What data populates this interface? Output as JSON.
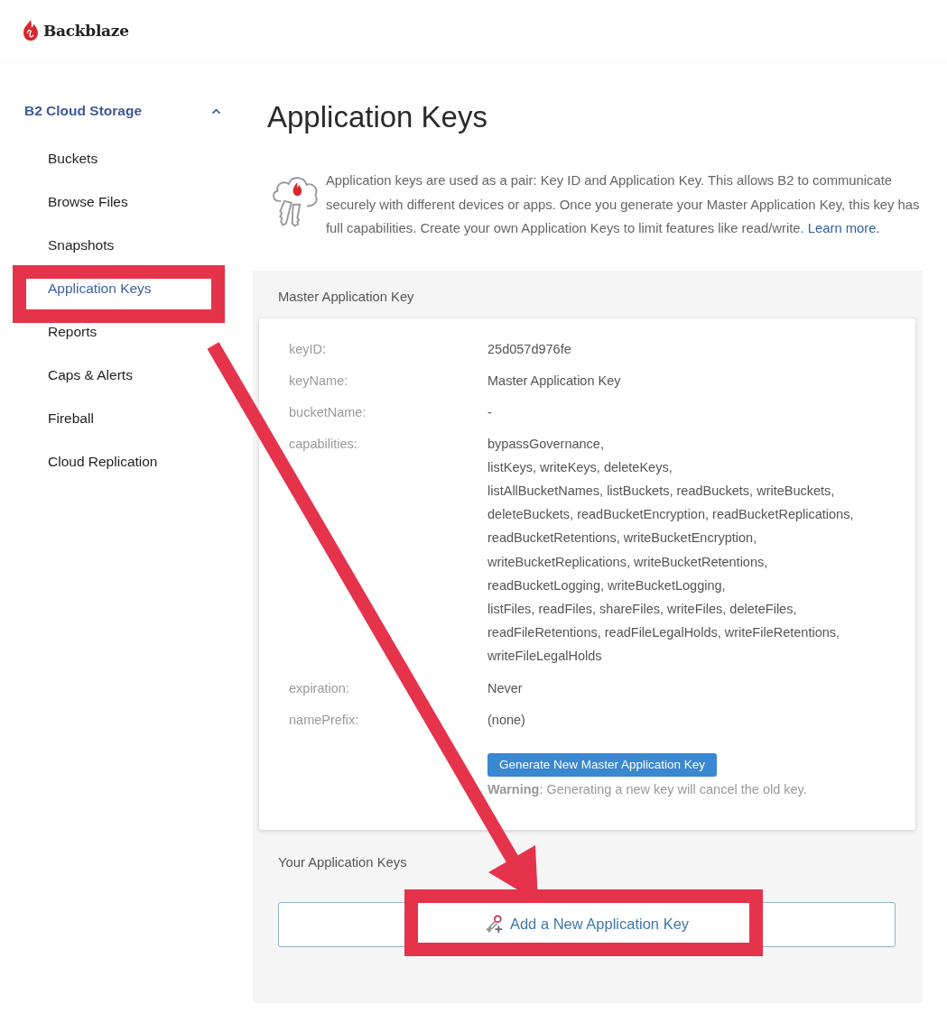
{
  "header": {
    "brand": "Backblaze"
  },
  "sidebar": {
    "section": {
      "label": "B2 Cloud Storage",
      "expanded": true
    },
    "items": [
      {
        "label": "Buckets",
        "selected": false,
        "highlighted": false
      },
      {
        "label": "Browse Files",
        "selected": false,
        "highlighted": false
      },
      {
        "label": "Snapshots",
        "selected": false,
        "highlighted": false
      },
      {
        "label": "Application Keys",
        "selected": true,
        "highlighted": true
      },
      {
        "label": "Reports",
        "selected": false,
        "highlighted": false
      },
      {
        "label": "Caps & Alerts",
        "selected": false,
        "highlighted": false
      },
      {
        "label": "Fireball",
        "selected": false,
        "highlighted": false
      },
      {
        "label": "Cloud Replication",
        "selected": false,
        "highlighted": false
      }
    ]
  },
  "page": {
    "title": "Application Keys",
    "intro": "Application keys are used as a pair: Key ID and Application Key. This allows B2 to communicate securely with different devices or apps. Once you generate your Master Application Key, this key has full capabilities. Create your own Application Keys to limit features like read/write.",
    "intro_link": "Learn more."
  },
  "master_key": {
    "heading": "Master Application Key",
    "fields": [
      {
        "kind": "text",
        "label": "keyID:",
        "value": "25d057d976fe"
      },
      {
        "kind": "text",
        "label": "keyName:",
        "value": "Master Application Key"
      },
      {
        "kind": "text",
        "label": "bucketName:",
        "value": "-"
      },
      {
        "kind": "list",
        "label": "capabilities:",
        "lines": [
          "bypassGovernance,",
          "listKeys, writeKeys, deleteKeys,",
          "listAllBucketNames, listBuckets, readBuckets, writeBuckets,",
          "deleteBuckets, readBucketEncryption, readBucketReplications,",
          "readBucketRetentions, writeBucketEncryption,",
          "writeBucketReplications, writeBucketRetentions,",
          "readBucketLogging, writeBucketLogging,",
          "listFiles, readFiles, shareFiles, writeFiles, deleteFiles,",
          "readFileRetentions, readFileLegalHolds, writeFileRetentions,",
          "writeFileLegalHolds"
        ]
      },
      {
        "kind": "text",
        "label": "expiration:",
        "value": "Never"
      },
      {
        "kind": "text",
        "label": "namePrefix:",
        "value": "(none)"
      }
    ],
    "button": "Generate New Master Application Key",
    "warning": "**Warning**: Generating a new key will cancel the old key."
  },
  "your_keys": {
    "heading": "Your Application Keys",
    "add_button": {
      "label": "Add a New Application Key",
      "highlighted": true
    }
  },
  "annotation_arrow": true
}
